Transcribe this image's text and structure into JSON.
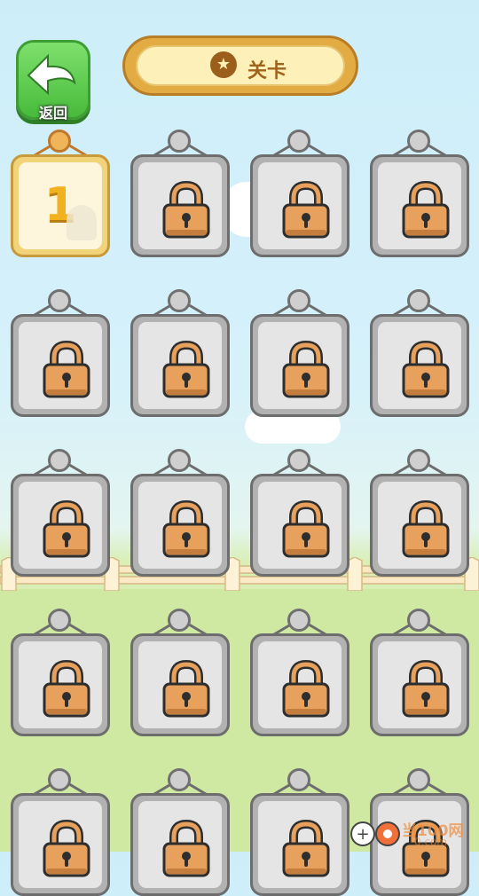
{
  "header": {
    "back_label": "返回",
    "title": "关卡",
    "trophy_icon": "trophy-star-icon"
  },
  "levels": [
    {
      "number": "1",
      "locked": false
    },
    {
      "locked": true
    },
    {
      "locked": true
    },
    {
      "locked": true
    },
    {
      "locked": true
    },
    {
      "locked": true
    },
    {
      "locked": true
    },
    {
      "locked": true
    },
    {
      "locked": true
    },
    {
      "locked": true
    },
    {
      "locked": true
    },
    {
      "locked": true
    },
    {
      "locked": true
    },
    {
      "locked": true
    },
    {
      "locked": true
    },
    {
      "locked": true
    },
    {
      "locked": true
    },
    {
      "locked": true
    },
    {
      "locked": true
    },
    {
      "locked": true
    }
  ],
  "watermark": {
    "text": "当100网",
    "sub": "0.com"
  },
  "colors": {
    "lock": "#e7a15d",
    "board": "#b2b2b2",
    "accent": "#e2ac42",
    "back": "#47bb3b"
  }
}
